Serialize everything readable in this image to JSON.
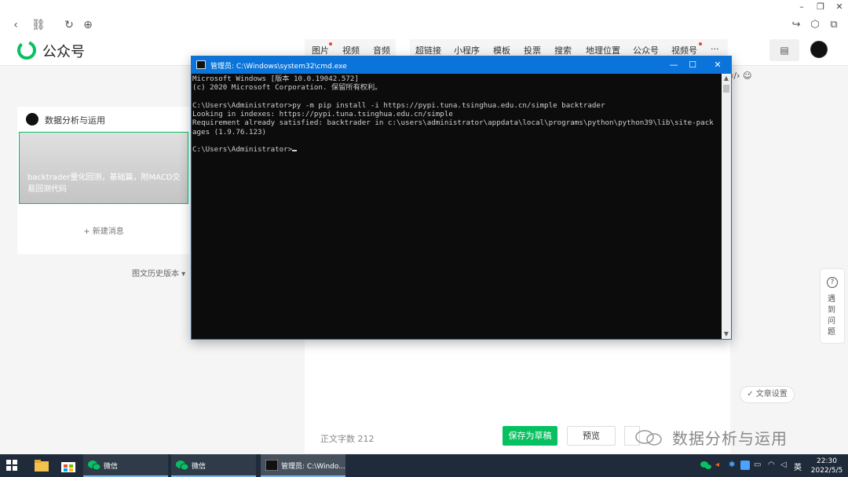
{
  "chrome": {
    "back": "‹",
    "link": "⛓",
    "reload": "↻",
    "globe": "⊕",
    "minimize": "–",
    "restore": "❐",
    "close": "✕",
    "share": "↪",
    "cube": "⬡",
    "lock": "⧉"
  },
  "app": {
    "title": "公众号",
    "toolbar": [
      "图片",
      "视频",
      "音频",
      "超链接",
      "小程序",
      "模板",
      "投票",
      "搜索",
      "地理位置",
      "公众号",
      "视频号",
      "···"
    ],
    "doc_icon": "▤"
  },
  "left": {
    "account_name": "数据分析与运用",
    "article_title": "backtrader量化回测，基础篇，附MACD交易回测代码",
    "new_message": "+ 新建消息",
    "history": "图文历史版本 ▾"
  },
  "editor": {
    "subbar": "‹/›  ☺",
    "word_count": "正文字数  212",
    "save_draft": "保存为草稿",
    "preview": "预览",
    "article_settings": "✓ 文章设置",
    "help_icon": "?",
    "help_text": "遇到问题"
  },
  "watermark": "数据分析与运用",
  "cmd": {
    "title": "管理员: C:\\Windows\\system32\\cmd.exe",
    "min": "—",
    "max": "☐",
    "close": "✕",
    "lines": [
      "Microsoft Windows [版本 10.0.19042.572]",
      "(c) 2020 Microsoft Corporation. 保留所有权利。",
      "",
      "C:\\Users\\Administrator>py -m pip install -i https://pypi.tuna.tsinghua.edu.cn/simple backtrader",
      "Looking in indexes: https://pypi.tuna.tsinghua.edu.cn/simple",
      "Requirement already satisfied: backtrader in c:\\users\\administrator\\appdata\\local\\programs\\python\\python39\\lib\\site-pack",
      "ages (1.9.76.123)",
      "",
      "C:\\Users\\Administrator>"
    ],
    "scroll_up": "▲",
    "scroll_down": "▼"
  },
  "taskbar": {
    "apps": [
      {
        "label": "微信"
      },
      {
        "label": "微信"
      },
      {
        "label": "管理员: C:\\Windo..."
      }
    ],
    "ime": "英",
    "time": "22:30",
    "date": "2022/5/5"
  },
  "colors": {
    "accent": "#07c160",
    "cmd_title": "#0a74da",
    "taskbar": "#1f2b3a"
  }
}
